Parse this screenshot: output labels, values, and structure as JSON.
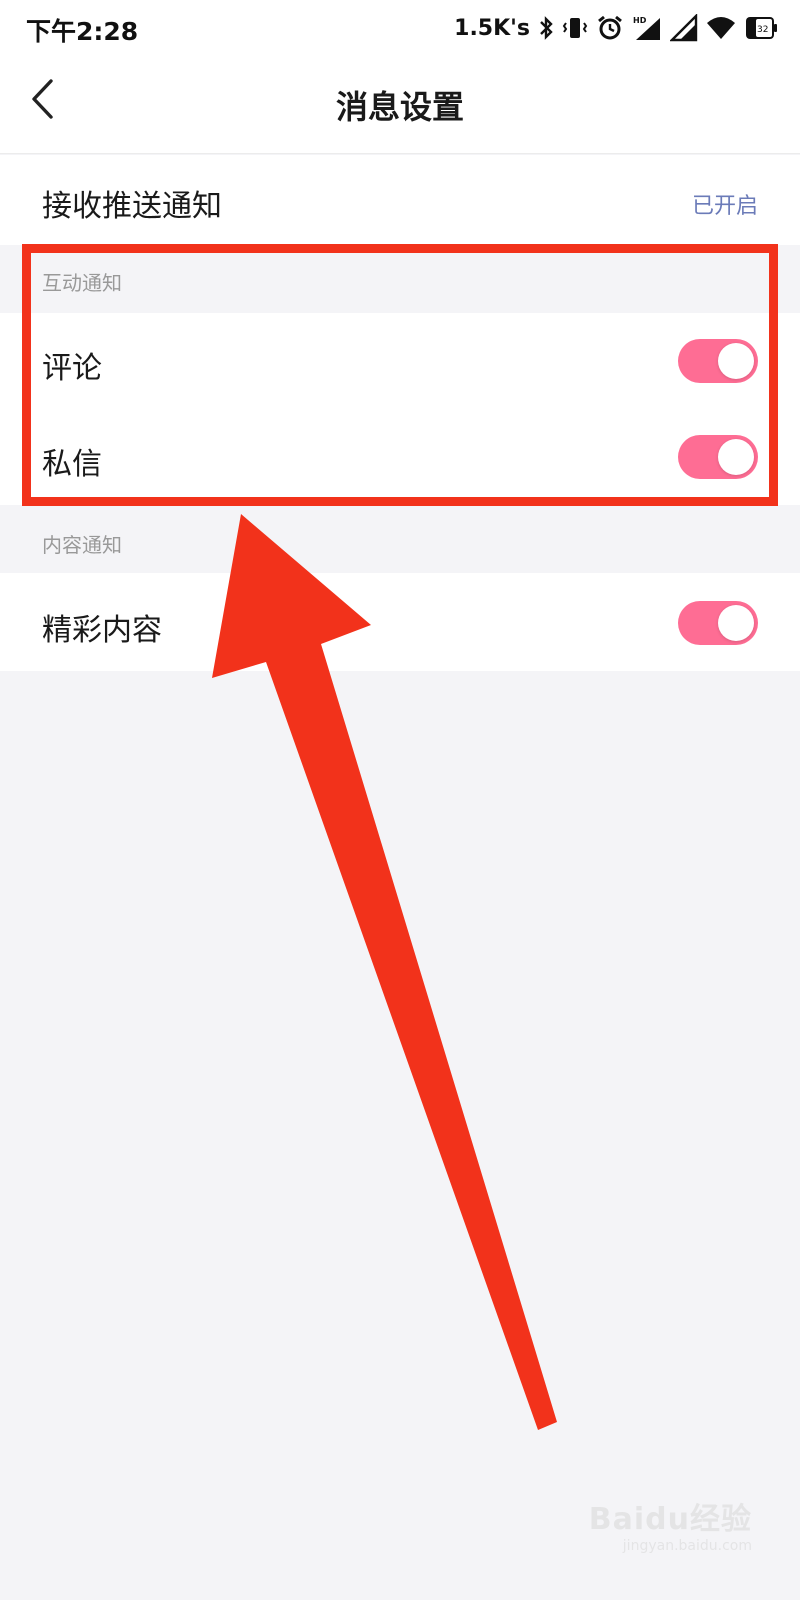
{
  "status_bar": {
    "time": "下午2:28",
    "network_speed": "1.5K's",
    "icons": [
      "bluetooth-icon",
      "vibrate-icon",
      "alarm-icon",
      "hd-signal-icon",
      "signal-icon",
      "wifi-icon",
      "battery-icon"
    ],
    "battery_level": "32"
  },
  "header": {
    "back_icon": "chevron-left-icon",
    "title": "消息设置"
  },
  "push_notification": {
    "label": "接收推送通知",
    "value": "已开启"
  },
  "sections": [
    {
      "header": "互动通知",
      "items": [
        {
          "label": "评论",
          "enabled": true
        },
        {
          "label": "私信",
          "enabled": true
        }
      ]
    },
    {
      "header": "内容通知",
      "items": [
        {
          "label": "精彩内容",
          "enabled": true
        }
      ]
    }
  ],
  "colors": {
    "toggle_on": "#fe6d94",
    "annotation": "#f2321b",
    "value_text": "#6b7bb8",
    "background": "#f4f4f7"
  },
  "watermark": {
    "brand": "Baidu经验",
    "url": "jingyan.baidu.com"
  }
}
